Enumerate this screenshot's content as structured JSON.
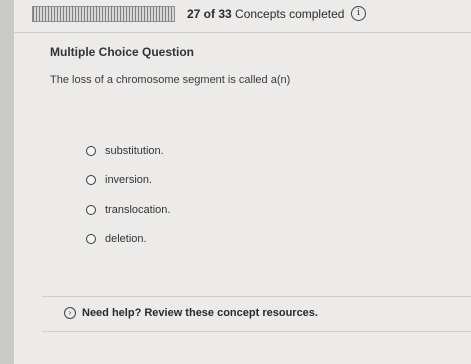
{
  "header": {
    "progress_count": "27 of 33",
    "progress_label": "Concepts completed",
    "progress_fraction": 0.818,
    "info_icon": "info-icon"
  },
  "question": {
    "type": "Multiple Choice Question",
    "text": "The loss of a chromosome segment is called a(n)",
    "options": [
      {
        "label": "substitution."
      },
      {
        "label": "inversion."
      },
      {
        "label": "translocation."
      },
      {
        "label": "deletion."
      }
    ]
  },
  "help": {
    "label": "Need help? Review these concept resources.",
    "icon": "chevron-circle-icon"
  }
}
